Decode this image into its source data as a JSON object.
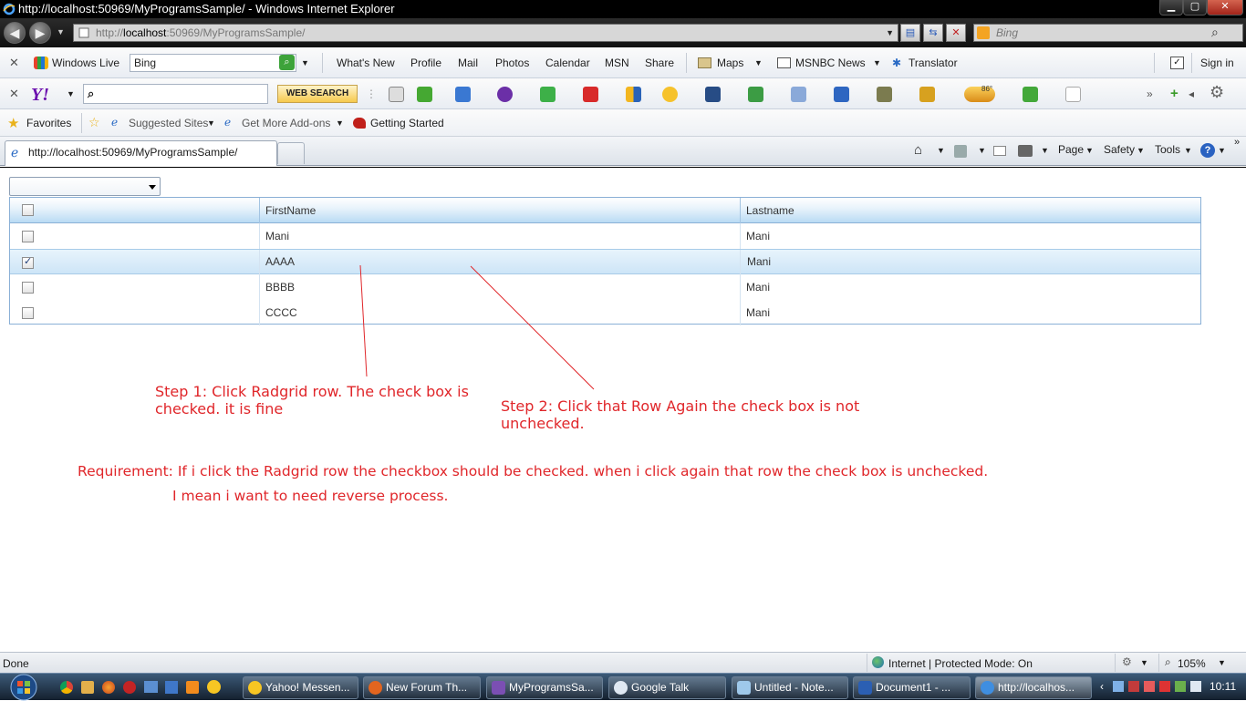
{
  "window": {
    "title": "http://localhost:50969/MyProgramsSample/ - Windows Internet Explorer",
    "minimize_label": "▁",
    "maximize_label": "▢",
    "close_label": "✕"
  },
  "address_bar": {
    "url_prefix": "http://",
    "url_host": "localhost",
    "url_rest": ":50969/MyProgramsSample/",
    "search_placeholder": "Bing"
  },
  "live_toolbar": {
    "brand": "Windows Live",
    "search_value": "Bing",
    "links": [
      "What's New",
      "Profile",
      "Mail",
      "Photos",
      "Calendar",
      "MSN",
      "Share"
    ],
    "maps": "Maps",
    "msnbc": "MSNBC News",
    "translator": "Translator",
    "sign_in": "Sign in"
  },
  "yahoo_toolbar": {
    "logo": "Y!",
    "search_button": "WEB SEARCH",
    "weather_badge": "86°"
  },
  "favorites_bar": {
    "favorites": "Favorites",
    "suggested_sites": "Suggested Sites",
    "get_more_addons": "Get More Add-ons",
    "getting_started": "Getting Started"
  },
  "tabs": {
    "active": "http://localhost:50969/MyProgramsSample/"
  },
  "command_bar": {
    "page": "Page",
    "safety": "Safety",
    "tools": "Tools"
  },
  "grid": {
    "columns": [
      "",
      "FirstName",
      "Lastname"
    ],
    "rows": [
      {
        "checked": false,
        "first": "Mani",
        "last": "Mani"
      },
      {
        "checked": true,
        "first": "AAAA",
        "last": "Mani"
      },
      {
        "checked": false,
        "first": "BBBB",
        "last": "Mani"
      },
      {
        "checked": false,
        "first": "CCCC",
        "last": "Mani"
      }
    ]
  },
  "annotations": {
    "step1_line1": "Step 1: Click Radgrid row. The check box is",
    "step1_line2": "checked. it is fine",
    "step2_line1": "Step 2: Click that Row Again the check box is not",
    "step2_line2": "unchecked.",
    "requirement_line1": "Requirement: If i click the Radgrid row the checkbox should be checked. when i click again that row the check box is unchecked.",
    "requirement_line2": "I mean i want to need reverse process.",
    "color": "#e0262a"
  },
  "status_bar": {
    "left": "Done",
    "zone": "Internet | Protected Mode: On",
    "zoom": "105%"
  },
  "taskbar": {
    "items": [
      "Yahoo! Messen...",
      "New Forum Th...",
      "MyProgramsSa...",
      "Google Talk",
      "Untitled - Note...",
      "Document1 - ...",
      "http://localhos..."
    ],
    "clock": "10:11"
  }
}
